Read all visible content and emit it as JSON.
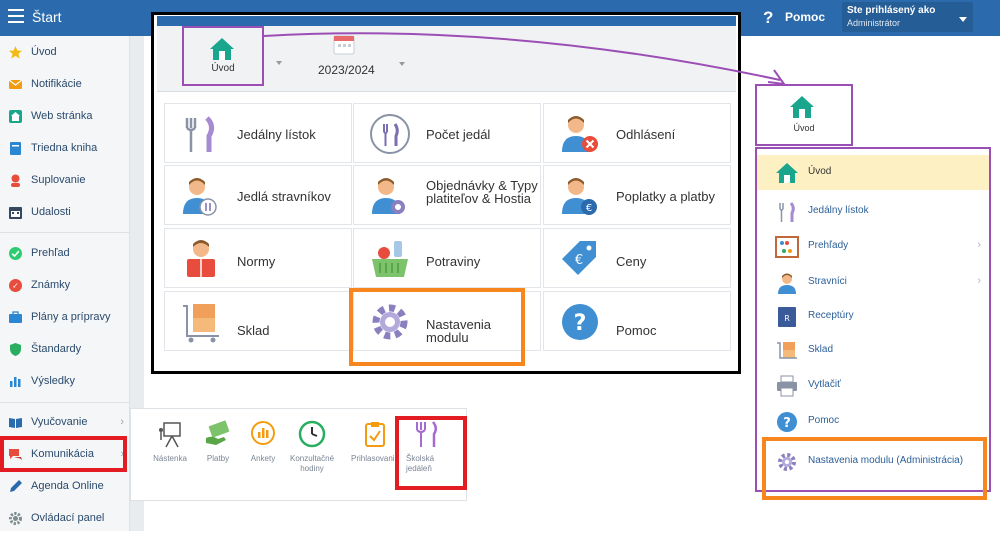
{
  "topbar": {
    "app_title": "Štart",
    "help_label": "Pomoc",
    "user_line1": "Ste prihlásený ako",
    "user_line2": "Administrátor"
  },
  "sidebar": {
    "items": [
      {
        "label": "Úvod",
        "icon": "star-icon",
        "color": "#f5b915"
      },
      {
        "label": "Notifikácie",
        "icon": "envelope-icon",
        "color": "#f39c12"
      },
      {
        "label": "Web stránka",
        "icon": "home-icon",
        "color": "#1aa68c"
      },
      {
        "label": "Triedna kniha",
        "icon": "book-icon",
        "color": "#2b87d1"
      },
      {
        "label": "Suplovanie",
        "icon": "substitution-icon",
        "color": "#e74c3c"
      },
      {
        "label": "Udalosti",
        "icon": "calendar-icon",
        "color": "#34495e"
      },
      {
        "label": "Prehľad",
        "icon": "check-circle-icon",
        "color": "#2ecc71"
      },
      {
        "label": "Známky",
        "icon": "grades-icon",
        "color": "#e74c3c"
      },
      {
        "label": "Plány a prípravy",
        "icon": "briefcase-icon",
        "color": "#2b87d1"
      },
      {
        "label": "Štandardy",
        "icon": "shield-icon",
        "color": "#27ae60"
      },
      {
        "label": "Výsledky",
        "icon": "bar-chart-icon",
        "color": "#2b87d1"
      },
      {
        "label": "Vyučovanie",
        "icon": "book-open-icon",
        "color": "#2b6bad"
      },
      {
        "label": "Komunikácia",
        "icon": "chat-icon",
        "color": "#e74c3c"
      },
      {
        "label": "Agenda Online",
        "icon": "pen-icon",
        "color": "#2b6bad"
      },
      {
        "label": "Ovládací panel",
        "icon": "gear-icon",
        "color": "#7f8c8d"
      }
    ]
  },
  "tabs": {
    "home_label": "Úvod",
    "year_label": "2023/2024"
  },
  "tiles": [
    {
      "label": "Jedálny lístok"
    },
    {
      "label": "Počet jedál"
    },
    {
      "label": "Odhlásení"
    },
    {
      "label": "Jedlá stravníkov"
    },
    {
      "label": "Objednávky & Typy platiteľov & Hostia"
    },
    {
      "label": "Poplatky a platby"
    },
    {
      "label": "Normy"
    },
    {
      "label": "Potraviny"
    },
    {
      "label": "Ceny"
    },
    {
      "label": "Sklad"
    },
    {
      "label": "Nastavenia modulu"
    },
    {
      "label": "Pomoc"
    }
  ],
  "right_menu": {
    "home_label": "Úvod",
    "items": [
      {
        "label": "Úvod"
      },
      {
        "label": "Jedálny lístok"
      },
      {
        "label": "Prehľady"
      },
      {
        "label": "Stravníci"
      },
      {
        "label": "Receptúry"
      },
      {
        "label": "Sklad"
      },
      {
        "label": "Vytlačiť"
      },
      {
        "label": "Pomoc"
      },
      {
        "label": "Nastavenia modulu (Administrácia)"
      }
    ]
  },
  "flyout": {
    "items": [
      {
        "label": "Nástenka"
      },
      {
        "label": "Platby"
      },
      {
        "label": "Ankety"
      },
      {
        "label": "Konzultačné hodiny"
      },
      {
        "label": "Prihlasovanie"
      },
      {
        "label": "Školská jedáleň"
      }
    ]
  },
  "colors": {
    "brand_blue": "#2b6bad",
    "highlight_red": "#e31b23",
    "highlight_orange": "#f7861e",
    "highlight_purple": "#9b4fb5",
    "active_row": "#fdf0c2"
  }
}
